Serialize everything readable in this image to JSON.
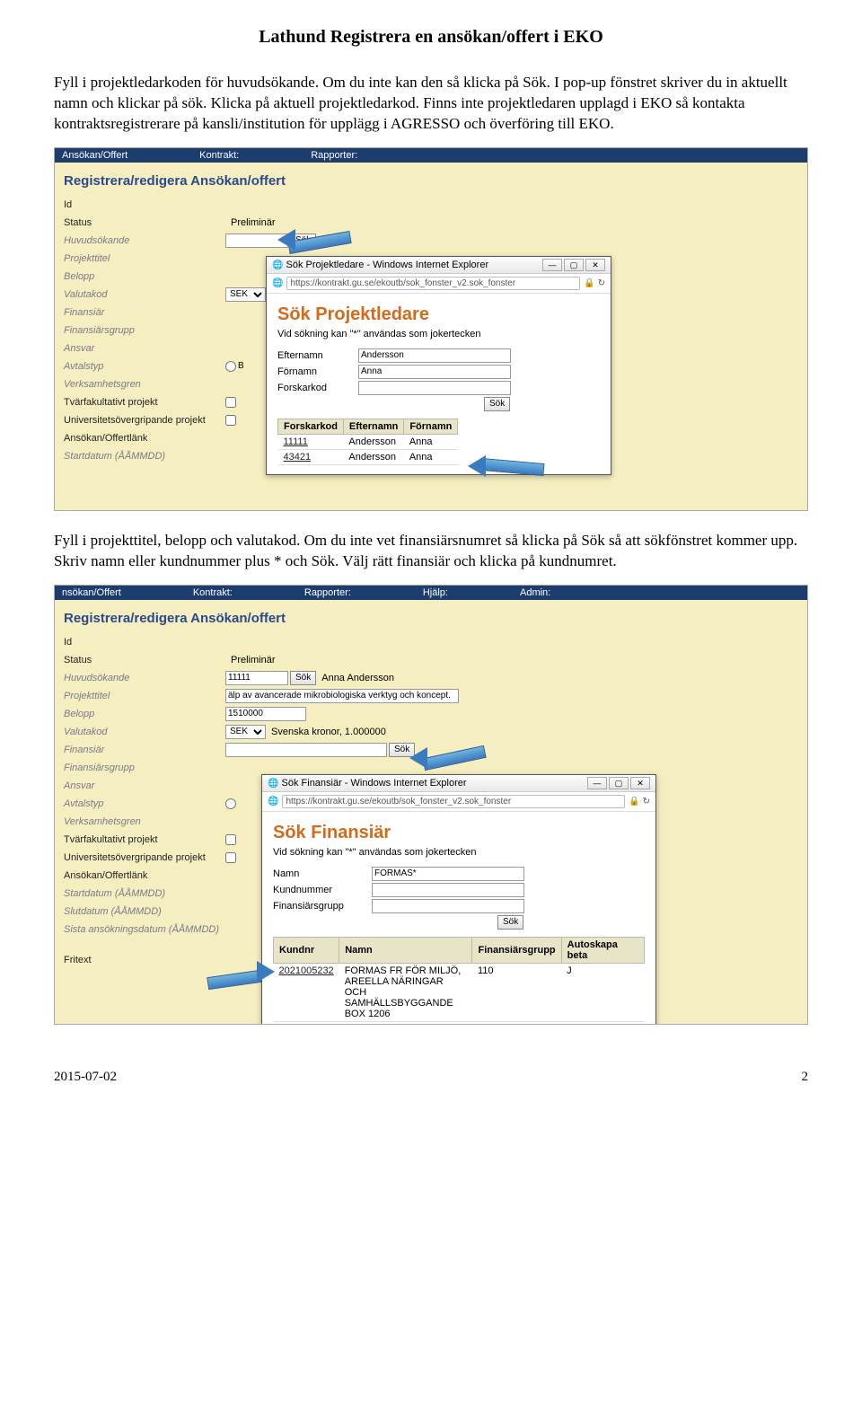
{
  "doc": {
    "title": "Lathund Registrera en ansökan/offert i EKO",
    "para1": "Fyll i projektledarkoden för huvudsökande. Om du inte kan den så klicka på Sök. I pop-up fönstret skriver du in aktuellt namn och klickar på sök. Klicka på aktuell projektledarkod. Finns inte projektledaren upplagd i EKO så kontakta kontraktsregistrerare på kansli/institution för upplägg i AGRESSO och överföring till EKO.",
    "para2": "Fyll i projekttitel, belopp och valutakod. Om du inte vet finansiärsnumret så klicka på Sök så att sökfönstret kommer upp. Skriv namn eller kundnummer plus * och Sök. Välj rätt finansiär och klicka på kundnumret.",
    "footer_date": "2015-07-02",
    "footer_page": "2"
  },
  "shot1": {
    "menu": {
      "m1": "Ansökan/Offert",
      "m2": "Kontrakt:",
      "m3": "Rapporter:"
    },
    "form_title": "Registrera/redigera Ansökan/offert",
    "labels": {
      "id": "Id",
      "status": "Status",
      "huvudsokande": "Huvudsökande",
      "projekttitel": "Projekttitel",
      "belopp": "Belopp",
      "valutakod": "Valutakod",
      "finansiar": "Finansiär",
      "finansiargrupp": "Finansiärsgrupp",
      "ansvar": "Ansvar",
      "avtalstyp": "Avtalstyp",
      "verksamhetsgren": "Verksamhetsgren",
      "tvarfakultativt": "Tvärfakultativt projekt",
      "univ": "Universitetsövergripande projekt",
      "lank": "Ansökan/Offertlänk",
      "startdatum": "Startdatum (ÅÅMMDD)"
    },
    "status_val": "Preliminär",
    "sek": "SEK",
    "sok": "Sök",
    "radio_b": "B",
    "popup": {
      "win_title": "Sök Projektledare - Windows Internet Explorer",
      "url": "https://kontrakt.gu.se/ekoutb/sok_fonster_v2.sok_fonster",
      "h1": "Sök Projektledare",
      "desc": "Vid sökning kan \"*\" användas som jokertecken",
      "efternamn_l": "Efternamn",
      "fornamn_l": "Förnamn",
      "forskarkod_l": "Forskarkod",
      "efternamn_v": "Andersson",
      "fornamn_v": "Anna",
      "th1": "Forskarkod",
      "th2": "Efternamn",
      "th3": "Förnamn",
      "r1c1": "11111",
      "r1c2": "Andersson",
      "r1c3": "Anna",
      "r2c1": "43421",
      "r2c2": "Andersson",
      "r2c3": "Anna"
    }
  },
  "shot2": {
    "menu": {
      "m1": "nsökan/Offert",
      "m2": "Kontrakt:",
      "m3": "Rapporter:",
      "m4": "Hjälp:",
      "m5": "Admin:"
    },
    "form_title": "Registrera/redigera Ansökan/offert",
    "labels": {
      "id": "Id",
      "status": "Status",
      "huvudsokande": "Huvudsökande",
      "projekttitel": "Projekttitel",
      "belopp": "Belopp",
      "valutakod": "Valutakod",
      "finansiar": "Finansiär",
      "finansiargrupp": "Finansiärsgrupp",
      "ansvar": "Ansvar",
      "avtalstyp": "Avtalstyp",
      "verksamhetsgren": "Verksamhetsgren",
      "tvarfakultativt": "Tvärfakultativt projekt",
      "univ": "Universitetsövergripande projekt",
      "lank": "Ansökan/Offertlänk",
      "startdatum": "Startdatum (ÅÅMMDD)",
      "slutdatum": "Slutdatum (ÅÅMMDD)",
      "sista": "Sista ansökningsdatum (ÅÅMMDD)",
      "fritext": "Fritext"
    },
    "status_val": "Preliminär",
    "huvudsok_v": "11111",
    "huvudsok_name": "Anna Andersson",
    "projekttitel_v": "älp av avancerade mikrobiologiska verktyg och koncept.",
    "belopp_v": "1510000",
    "sek": "SEK",
    "sek_desc": "Svenska kronor, 1.000000",
    "sok": "Sök",
    "popup": {
      "win_title": "Sök Finansiär - Windows Internet Explorer",
      "url": "https://kontrakt.gu.se/ekoutb/sok_fonster_v2.sok_fonster",
      "h1": "Sök Finansiär",
      "desc": "Vid sökning kan \"*\" användas som jokertecken",
      "namn_l": "Namn",
      "kundnr_l": "Kundnummer",
      "fgrupp_l": "Finansiärsgrupp",
      "namn_v": "FORMAS*",
      "th1": "Kundnr",
      "th2": "Namn",
      "th3": "Finansiärsgrupp",
      "th4": "Autoskapa beta",
      "r1c1": "2021005232",
      "r1c2": "FORMAS FR FÖR MILJÖ, AREELLA NÄRINGAR OCH SAMHÄLLSBYGGANDE BOX 1206",
      "r1c3": "110",
      "r1c4": "J"
    }
  }
}
